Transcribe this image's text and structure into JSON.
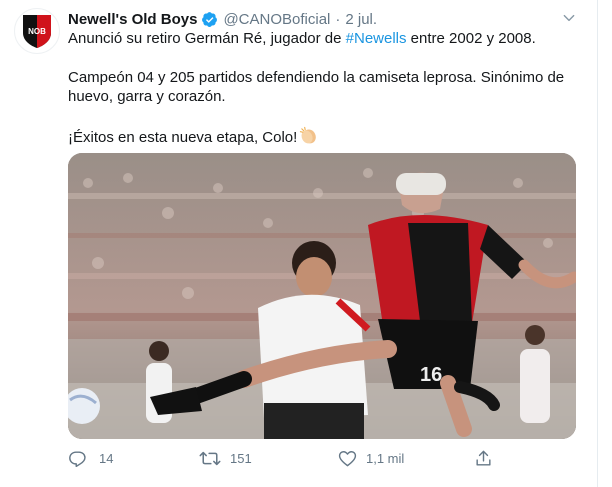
{
  "tweet": {
    "author": {
      "name": "Newell's Old Boys",
      "handle": "@CANOBoficial",
      "avatar_text": "NOB"
    },
    "time": "2 jul.",
    "separator": "·",
    "body": {
      "line1_prefix": "Anunció su retiro Germán Ré, jugador de ",
      "hashtag": "#Newells",
      "line1_suffix": " entre 2002 y 2008.",
      "paragraph2": "Campeón 04 y 205 partidos defendiendo la camiseta leprosa. Sinónimo de huevo, garra y corazón.",
      "paragraph3": "¡Éxitos en esta nueva etapa, Colo!"
    },
    "photo": {
      "jersey_number": "16"
    },
    "actions": {
      "replies": "14",
      "retweets": "151",
      "likes": "1,1 mil"
    }
  },
  "colors": {
    "accent": "#1b95e0",
    "muted": "#657786",
    "verified": "#1da1f2"
  },
  "icons": [
    "verified-badge-icon",
    "chevron-down-icon",
    "clapping-hands-icon",
    "reply-icon",
    "retweet-icon",
    "like-icon",
    "share-icon"
  ]
}
